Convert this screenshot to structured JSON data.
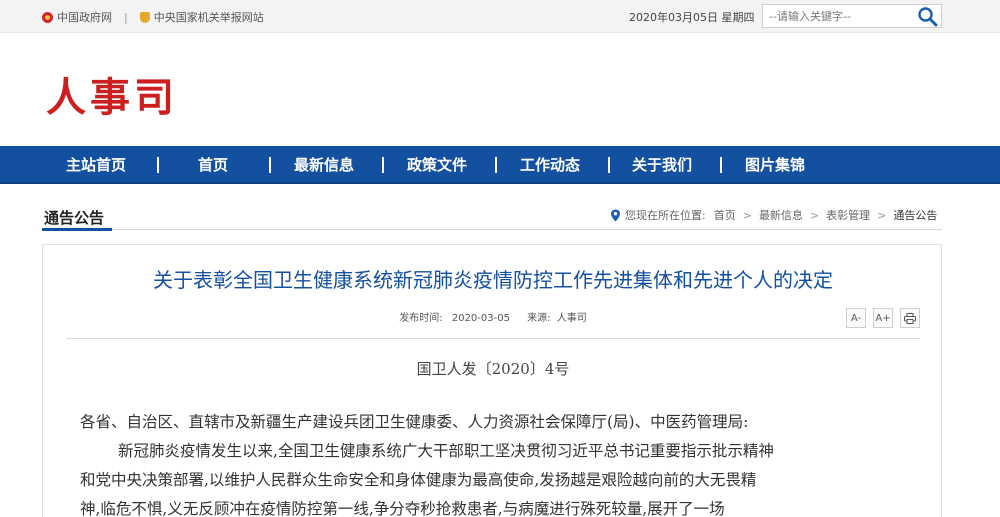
{
  "topbar": {
    "gov_link": "中国政府网",
    "separator": "|",
    "report_link": "中央国家机关举报网站",
    "date": "2020年03月05日 星期四",
    "search_placeholder": "--请输入关键字--"
  },
  "header": {
    "logo_text": "人事司"
  },
  "nav": {
    "items": [
      "主站首页",
      "首页",
      "最新信息",
      "政策文件",
      "工作动态",
      "关于我们",
      "图片集锦"
    ],
    "divider": "|"
  },
  "section": {
    "title": "通告公告"
  },
  "breadcrumb": {
    "prefix": "您现在所在位置:",
    "items": [
      "首页",
      "最新信息",
      "表彰管理",
      "通告公告"
    ],
    "arrow": ">"
  },
  "article": {
    "title": "关于表彰全国卫生健康系统新冠肺炎疫情防控工作先进集体和先进个人的决定",
    "publish_label": "发布时间:",
    "publish_date": "2020-03-05",
    "source_label": "来源:",
    "source": "人事司",
    "doc_number": "国卫人发〔2020〕4号",
    "addressee": "各省、自治区、直辖市及新疆生产建设兵团卫生健康委、人力资源社会保障厅(局)、中医药管理局:",
    "paragraph_lines": [
      "新冠肺炎疫情发生以来,全国卫生健康系统广大干部职工坚决贯彻习近平总书记重要指示批示精神",
      "和党中央决策部署,以维护人民群众生命安全和身体健康为最高使命,发扬越是艰险越向前的大无畏精",
      "神,临危不惧,义无反顾冲在疫情防控第一线,争分夺秒抢救患者,与病魔进行殊死较量,展开了一场"
    ]
  },
  "tools": {
    "font_smaller": "A-",
    "font_larger": "A+",
    "print_icon": "printer-icon"
  },
  "colors": {
    "brand_red": "#cc1f1f",
    "nav_blue": "#1450a0",
    "title_blue": "#1450a0"
  }
}
